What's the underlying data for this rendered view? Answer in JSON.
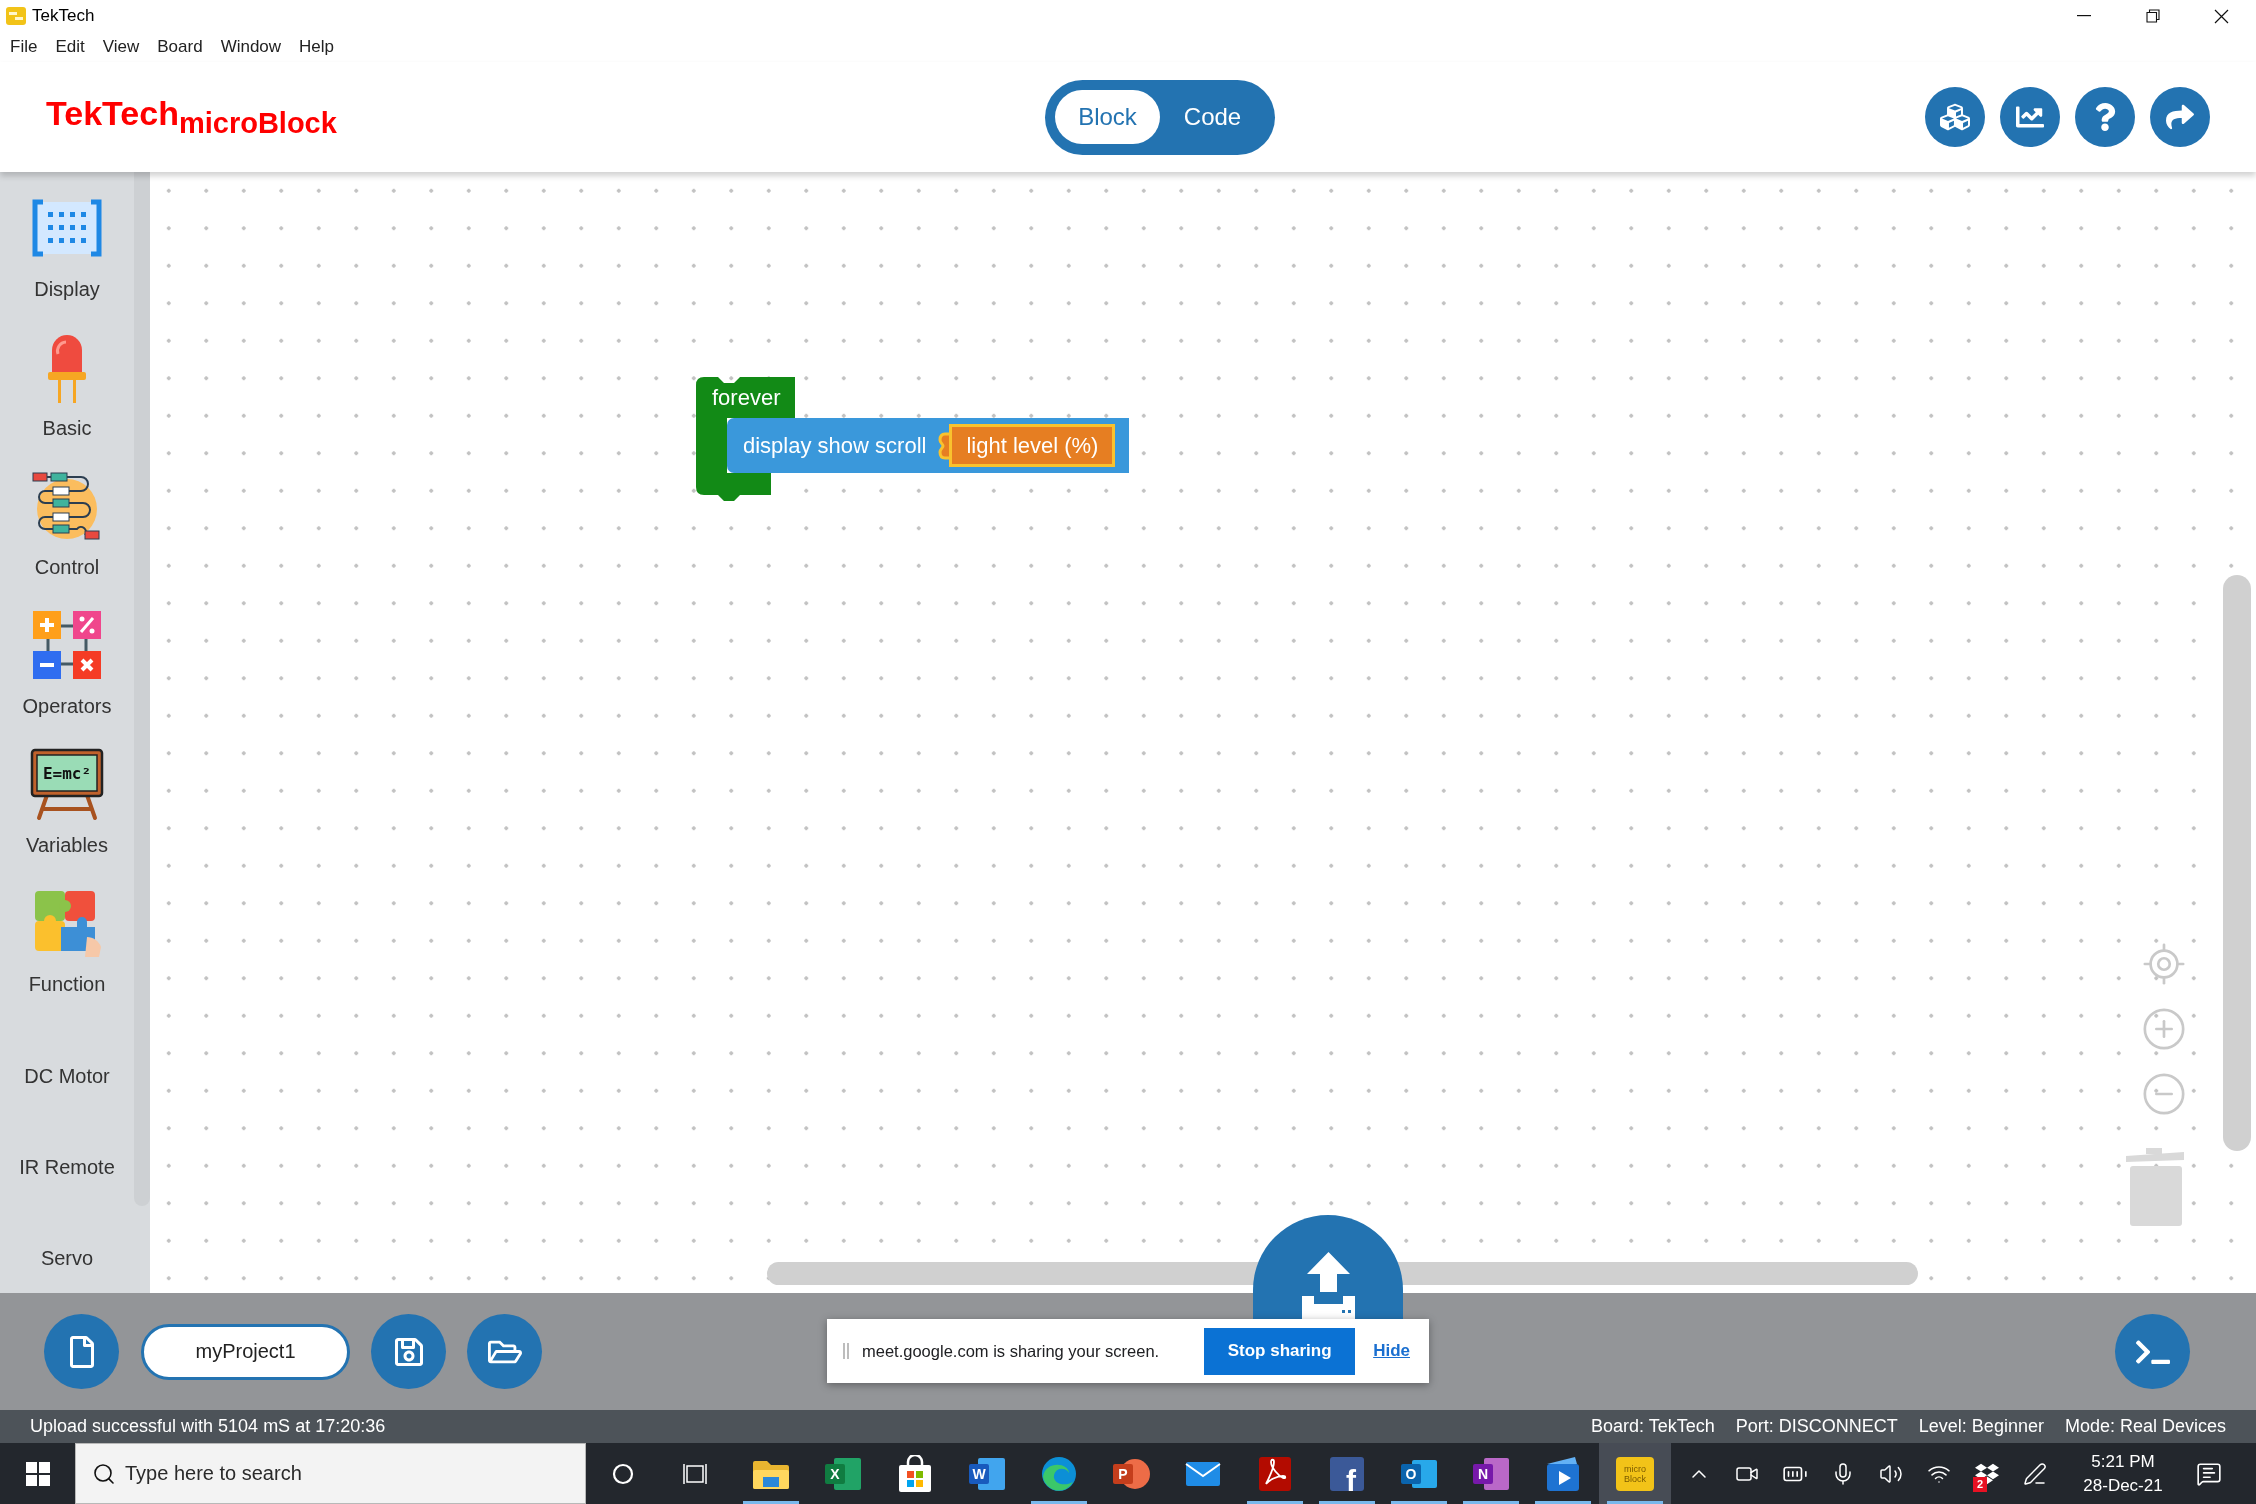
{
  "window": {
    "title": "TekTech"
  },
  "menu": [
    "File",
    "Edit",
    "View",
    "Board",
    "Window",
    "Help"
  ],
  "header": {
    "logo": {
      "main": "TekTech",
      "sub": "microBlock"
    },
    "view_toggle": [
      {
        "label": "Block",
        "selected": true
      },
      {
        "label": "Code",
        "selected": false
      }
    ]
  },
  "sidebar": {
    "categories": [
      {
        "label": "Display",
        "kind": "matrix"
      },
      {
        "label": "Basic",
        "kind": "led"
      },
      {
        "label": "Control",
        "kind": "flowchart"
      },
      {
        "label": "Operators",
        "kind": "operators"
      },
      {
        "label": "Variables",
        "kind": "chalkboard",
        "icon_text": "E=mc²"
      },
      {
        "label": "Function",
        "kind": "puzzle"
      },
      {
        "label": "DC Motor",
        "kind": "plain"
      },
      {
        "label": "IR Remote",
        "kind": "plain"
      },
      {
        "label": "Servo",
        "kind": "plain"
      }
    ]
  },
  "workspace": {
    "forever_block": {
      "label": "forever",
      "statement": {
        "label": "display show scroll",
        "input": "light level (%)"
      }
    }
  },
  "project": {
    "name": "myProject1"
  },
  "screen_share": {
    "message": "meet.google.com is sharing your screen.",
    "stop_button": "Stop sharing",
    "hide_link": "Hide"
  },
  "status_bar": {
    "message": "Upload successful with 5104 mS at 17:20:36",
    "items": [
      "Board: TekTech",
      "Port: DISCONNECT",
      "Level: Beginner",
      "Mode: Real Devices"
    ]
  },
  "taskbar": {
    "search": {
      "placeholder": "Type here to search"
    },
    "apps": [
      {
        "kind": "folder",
        "running": true,
        "selected": false
      },
      {
        "kind": "spreadsheet",
        "letter": "X",
        "running": false,
        "selected": false
      },
      {
        "kind": "store",
        "running": false,
        "selected": false
      },
      {
        "kind": "document",
        "letter": "W",
        "running": false,
        "selected": false
      },
      {
        "kind": "browser",
        "running": true,
        "selected": false
      },
      {
        "kind": "slides",
        "letter": "P",
        "running": false,
        "selected": false
      },
      {
        "kind": "mail",
        "running": false,
        "selected": false
      },
      {
        "kind": "pdf",
        "running": true,
        "selected": false
      },
      {
        "kind": "social",
        "letter": "f",
        "running": true,
        "selected": false
      },
      {
        "kind": "mailtile",
        "letter": "O",
        "running": true,
        "selected": false
      },
      {
        "kind": "notebook",
        "letter": "N",
        "running": true,
        "selected": false
      },
      {
        "kind": "video",
        "running": true,
        "selected": false
      },
      {
        "kind": "blocks",
        "icon_lines": [
          "micro",
          "Block"
        ],
        "running": true,
        "selected": true
      }
    ],
    "tray": {
      "badge": "2",
      "time": "5:21 PM",
      "date": "28-Dec-21"
    }
  }
}
